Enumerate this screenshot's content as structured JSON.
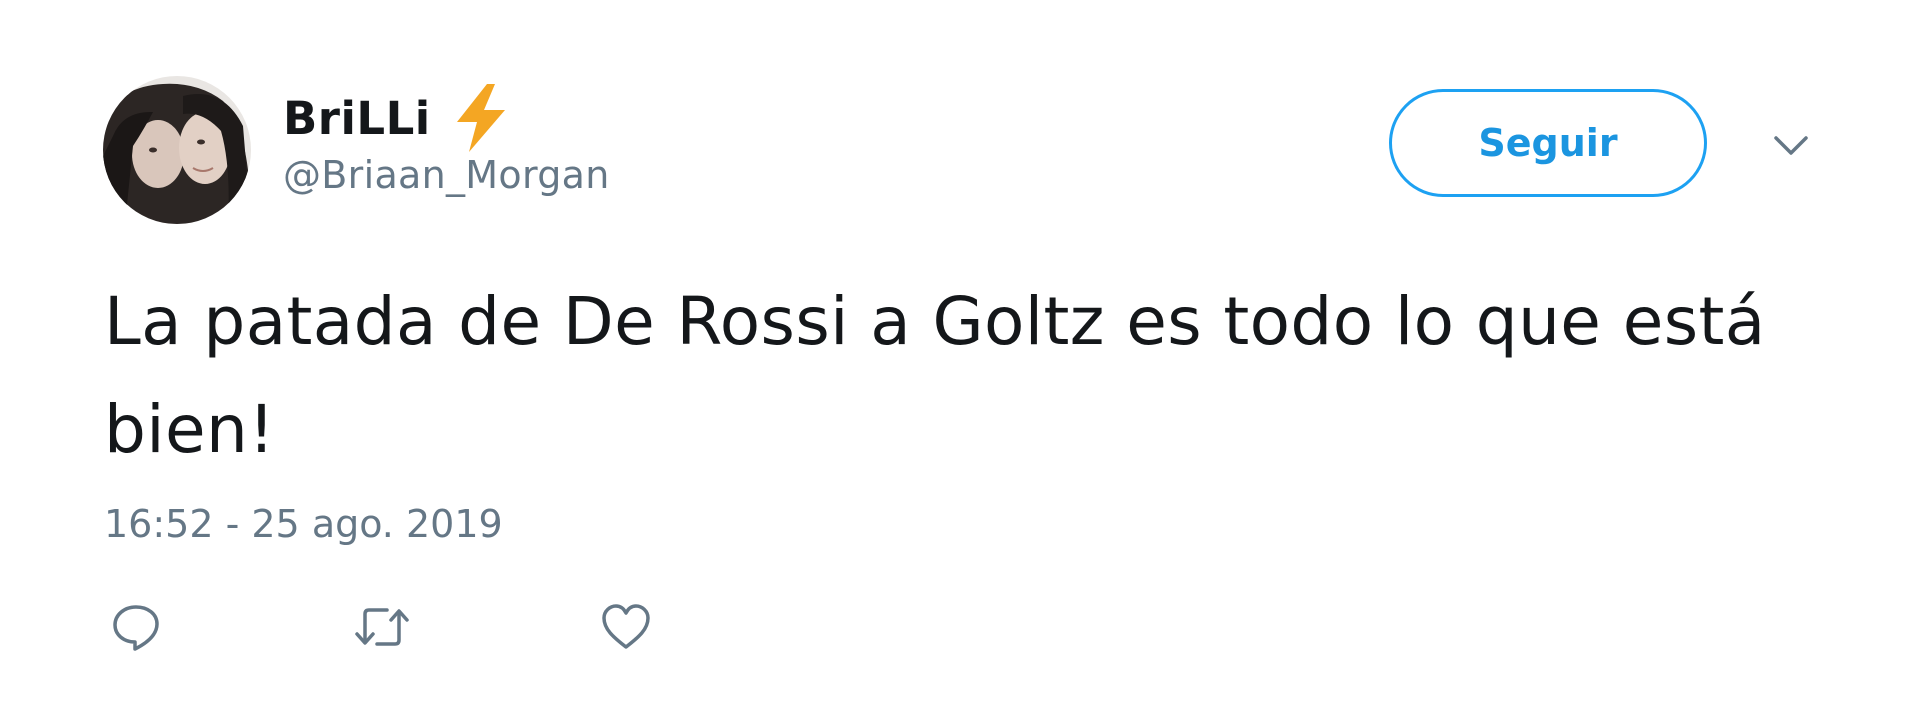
{
  "user": {
    "display_name": "BriLLi",
    "handle": "@Briaan_Morgan",
    "avatar_icon": "avatar-photo",
    "badge_icon": "lightning-bolt-icon",
    "badge_color": "#f4a623"
  },
  "follow_button": {
    "label": "Seguir",
    "color": "#1da1f2"
  },
  "menu": {
    "icon": "chevron-down-icon"
  },
  "tweet": {
    "text": "La patada de De Rossi a Goltz es todo lo que está bien!",
    "timestamp": "16:52 - 25 ago. 2019"
  },
  "actions": [
    {
      "icon": "reply-icon"
    },
    {
      "icon": "retweet-icon"
    },
    {
      "icon": "like-icon"
    }
  ]
}
